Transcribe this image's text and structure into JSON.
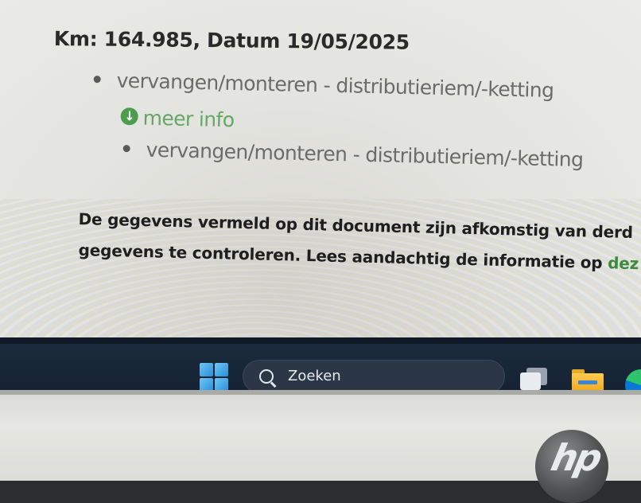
{
  "document": {
    "km_heading": "Km: 164.985, Datum 19/05/2025",
    "items": [
      "vervangen/monteren - distributieriem/-ketting",
      "vervangen/monteren - distributieriem/-ketting"
    ],
    "meer_info": "meer info",
    "notice_line1": "De gegevens vermeld op dit document zijn afkomstig van derd",
    "notice_line2_text": "gegevens te controleren. Lees aandachtig de informatie op ",
    "notice_line2_link": "dez"
  },
  "taskbar": {
    "search_placeholder": "Zoeken",
    "icons": [
      "windows-start-icon",
      "search-icon",
      "task-view-icon",
      "file-explorer-icon",
      "edge-icon"
    ]
  },
  "device": {
    "logo_text": "hp"
  },
  "colors": {
    "link_green": "#3c8a3c",
    "meer_info_green": "#64a864",
    "taskbar_bg": "#1b2a3c"
  }
}
